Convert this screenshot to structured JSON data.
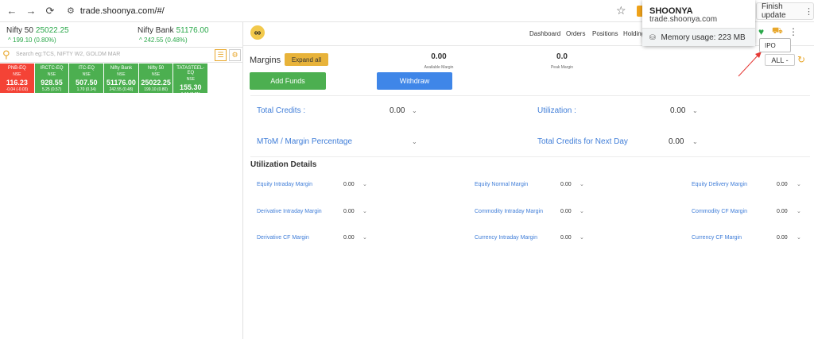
{
  "browser": {
    "url": "trade.shoonya.com/#/",
    "finish_update": "Finish update"
  },
  "tab_popup": {
    "title": "SHOONYA",
    "domain": "trade.shoonya.com",
    "memory": "Memory usage: 223 MB"
  },
  "indices": [
    {
      "name": "Nifty 50",
      "value": "25022.25",
      "change": "199.10 (0.80%)"
    },
    {
      "name": "Nifty Bank",
      "value": "51176.00",
      "change": "242.55 (0.48%)"
    }
  ],
  "search": {
    "placeholder": "Search eg:TCS, NIFTY W2, GOLDM MAR"
  },
  "tiles": [
    {
      "name": "PNB-EQ",
      "exch": "NSE",
      "price": "116.23",
      "change": "-0.04 (-0.03)",
      "color": "#f44336"
    },
    {
      "name": "IRCTC-EQ",
      "exch": "NSE",
      "price": "928.55",
      "change": "5.25 (0.57)",
      "color": "#4caf50"
    },
    {
      "name": "ITC-EQ",
      "exch": "NSE",
      "price": "507.50",
      "change": "1.70 (0.34)",
      "color": "#4caf50"
    },
    {
      "name": "Nifty Bank",
      "exch": "NSE",
      "price": "51176.00",
      "change": "242.55 (0.48)",
      "color": "#4caf50"
    },
    {
      "name": "Nifty 50",
      "exch": "NSE",
      "price": "25022.25",
      "change": "199.10 (0.80)",
      "color": "#4caf50"
    },
    {
      "name": "TATASTEEL-EQ",
      "exch": "NSE",
      "price": "155.30",
      "change": "1.10 (0.71)",
      "color": "#4caf50"
    }
  ],
  "menu": [
    "Dashboard",
    "Orders",
    "Positions",
    "Holding"
  ],
  "ipo": "IPO",
  "all": "ALL -",
  "margins": {
    "title": "Margins",
    "expand_all": "Expand all",
    "available_value": "0.00",
    "available_label": "Available Margin",
    "peak_value": "0.0",
    "peak_label": "Peak Margin",
    "add_funds": "Add Funds",
    "withdraw": "Withdraw"
  },
  "summary": [
    {
      "label": "Total Credits :",
      "value": "0.00"
    },
    {
      "label": "Utilization :",
      "value": "0.00"
    },
    {
      "label": "MToM / Margin Percentage",
      "value": ""
    },
    {
      "label": "Total Credits for Next Day",
      "value": "0.00"
    }
  ],
  "utilization": {
    "title": "Utilization Details",
    "items": [
      {
        "label": "Equity Intraday Margin",
        "value": "0.00"
      },
      {
        "label": "Equity Normal Margin",
        "value": "0.00"
      },
      {
        "label": "Equity Delivery Margin",
        "value": "0.00"
      },
      {
        "label": "Derivative Intraday Margin",
        "value": "0.00"
      },
      {
        "label": "Commodity Intraday Margin",
        "value": "0.00"
      },
      {
        "label": "Commodity CF Margin",
        "value": "0.00"
      },
      {
        "label": "Derivative CF Margin",
        "value": "0.00"
      },
      {
        "label": "Currency Intraday Margin",
        "value": "0.00"
      },
      {
        "label": "Currency CF Margin",
        "value": "0.00"
      }
    ]
  }
}
